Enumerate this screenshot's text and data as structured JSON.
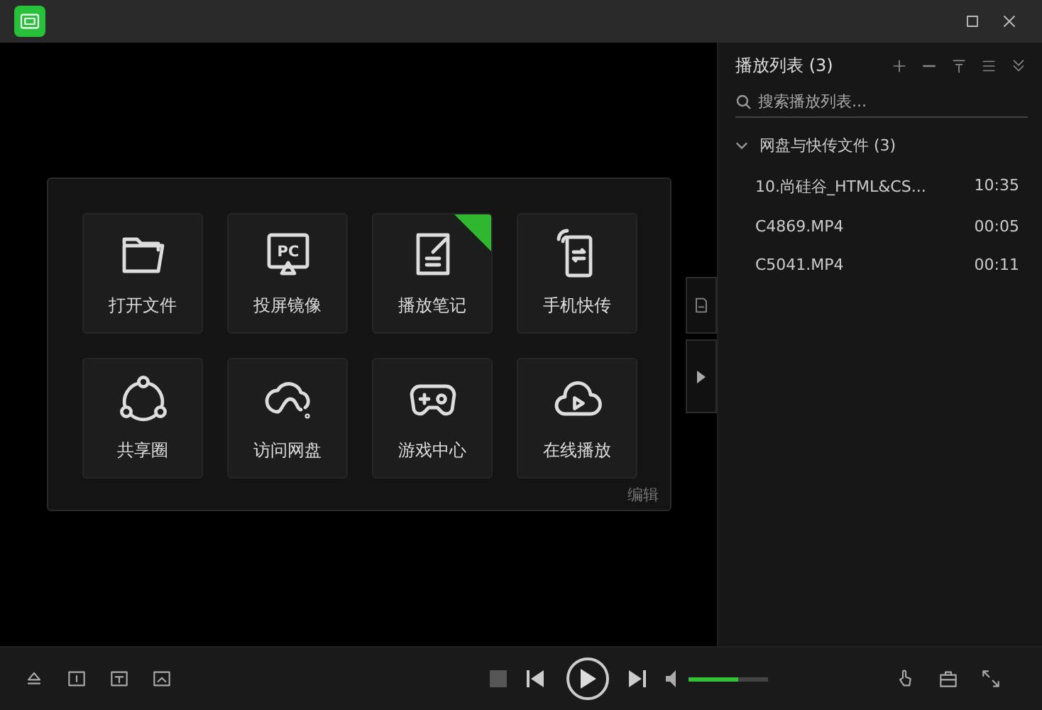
{
  "home_panel": {
    "tiles": [
      {
        "label": "打开文件",
        "is_new": false
      },
      {
        "label": "投屏镜像",
        "is_new": false,
        "icon_text": "PC"
      },
      {
        "label": "播放笔记",
        "is_new": true
      },
      {
        "label": "手机快传",
        "is_new": false
      },
      {
        "label": "共享圈",
        "is_new": false
      },
      {
        "label": "访问网盘",
        "is_new": false
      },
      {
        "label": "游戏中心",
        "is_new": false
      },
      {
        "label": "在线播放",
        "is_new": false
      }
    ],
    "edit_link": "编辑"
  },
  "playlist": {
    "title": "播放列表 (3)",
    "search": {
      "placeholder": "搜索播放列表..."
    },
    "groups": [
      {
        "label": "网盘与快传文件 (3)",
        "expanded": true,
        "items": [
          {
            "name": "10.尚硅谷_HTML&CS...",
            "duration": "10:35"
          },
          {
            "name": "C4869.MP4",
            "duration": "00:05"
          },
          {
            "name": "C5041.MP4",
            "duration": "00:11"
          }
        ]
      }
    ]
  },
  "controls": {
    "volume": {
      "level": 0.62
    }
  }
}
